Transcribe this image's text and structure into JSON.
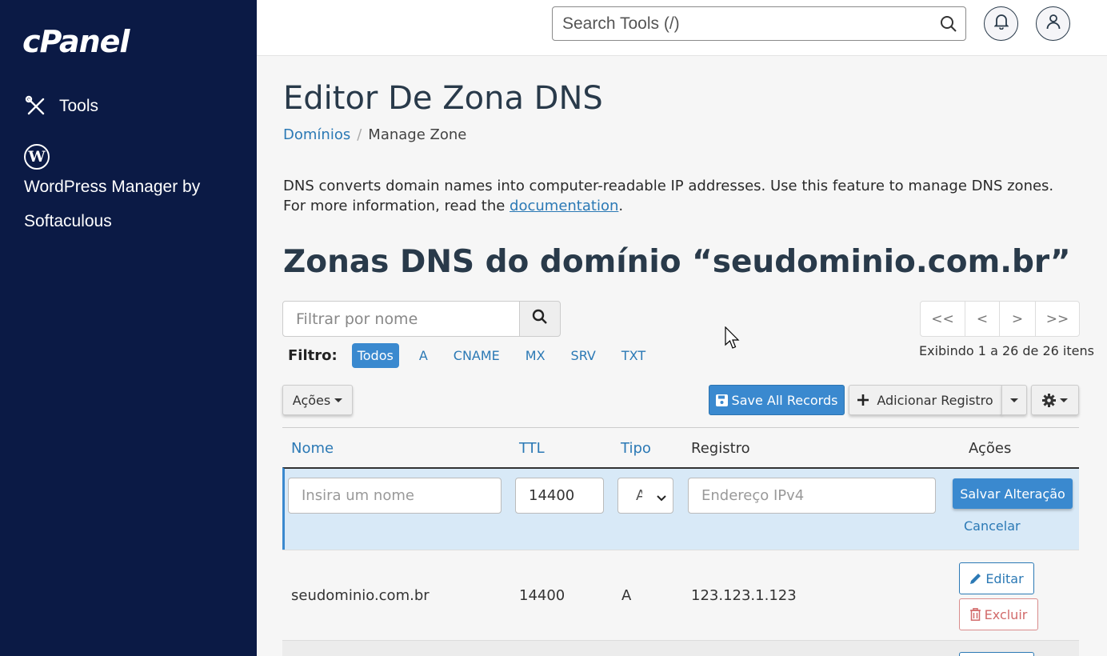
{
  "sidebar": {
    "logo": "cPanel",
    "items": [
      {
        "label": "Tools",
        "icon": "tools-icon"
      },
      {
        "label": "WordPress Manager by Softaculous",
        "icon": "wordpress-icon"
      }
    ]
  },
  "topbar": {
    "search_placeholder": "Search Tools (/)",
    "notifications_icon": "bell-icon",
    "user_icon": "user-icon"
  },
  "page": {
    "title": "Editor De Zona DNS",
    "breadcrumb": {
      "parent": "Domínios",
      "separator": "/",
      "current": "Manage Zone"
    },
    "description_text": "DNS converts domain names into computer-readable IP addresses. Use this feature to manage DNS zones. For more information, read the ",
    "description_link": "documentation",
    "description_end": ".",
    "zone_title": "Zonas DNS do domínio “seudominio.com.br”"
  },
  "filter": {
    "placeholder": "Filtrar por nome",
    "label": "Filtro:",
    "chips": [
      "Todos",
      "A",
      "CNAME",
      "MX",
      "SRV",
      "TXT"
    ],
    "active": "Todos"
  },
  "pagination": {
    "first": "<<",
    "prev": "<",
    "next": ">",
    "last": ">>",
    "showing": "Exibindo 1 a 26 de 26 itens"
  },
  "toolbar": {
    "actions_label": "Ações",
    "save_all_label": "Save All Records",
    "add_record_label": "Adicionar Registro"
  },
  "table": {
    "headers": {
      "name": "Nome",
      "ttl": "TTL",
      "type": "Tipo",
      "record": "Registro",
      "actions": "Ações"
    },
    "edit_row": {
      "name_placeholder": "Insira um nome",
      "ttl_value": "14400",
      "type_value": "A",
      "record_placeholder": "Endereço IPv4",
      "save_label": "Salvar Alteração",
      "cancel_label": "Cancelar"
    },
    "rows": [
      {
        "name": "seudominio.com.br",
        "ttl": "14400",
        "type": "A",
        "record": "123.123.1.123",
        "edit_label": "Editar",
        "delete_label": "Excluir"
      }
    ]
  },
  "colors": {
    "sidebar_bg": "#0b1a45",
    "primary": "#3a89cf",
    "link": "#2b79b5",
    "danger": "#d26a6a"
  }
}
